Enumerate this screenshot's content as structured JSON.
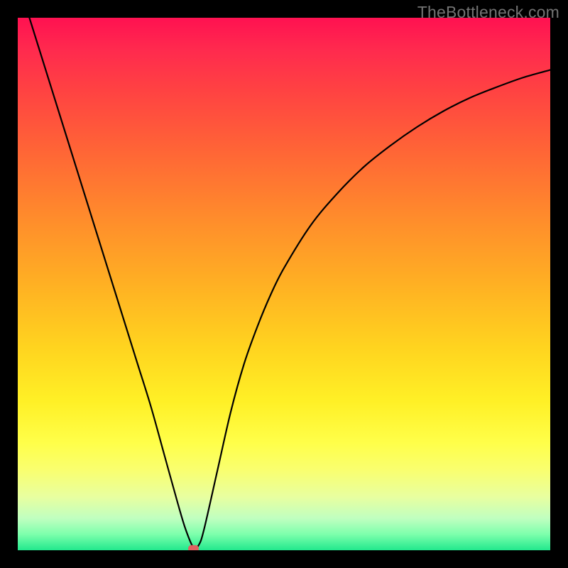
{
  "watermark": "TheBottleneck.com",
  "chart_data": {
    "type": "line",
    "title": "",
    "xlabel": "",
    "ylabel": "",
    "xlim": [
      0,
      100
    ],
    "ylim": [
      0,
      100
    ],
    "grid": false,
    "legend": false,
    "series": [
      {
        "name": "bottleneck-curve",
        "x": [
          0,
          2.5,
          5,
          7.5,
          10,
          12.5,
          15,
          17.5,
          20,
          22.5,
          25,
          27.5,
          30,
          31.5,
          33,
          34,
          35,
          37.5,
          40,
          42.5,
          45,
          47.5,
          50,
          55,
          60,
          65,
          70,
          75,
          80,
          85,
          90,
          95,
          100
        ],
        "y": [
          107,
          99,
          91,
          83,
          75,
          67,
          59,
          51,
          43,
          35,
          27,
          18,
          9,
          4,
          0.5,
          1,
          4,
          15,
          26,
          35,
          42,
          48,
          53,
          61,
          67,
          72,
          76,
          79.5,
          82.5,
          85,
          87,
          88.8,
          90.2
        ]
      }
    ],
    "marker": {
      "x": 33,
      "y": 0.3,
      "shape": "rounded-rect",
      "color": "#e06060"
    },
    "background_gradient": {
      "stops": [
        {
          "pos": 0,
          "color": "#ff1151"
        },
        {
          "pos": 0.5,
          "color": "#ffb023"
        },
        {
          "pos": 0.8,
          "color": "#ffff4a"
        },
        {
          "pos": 1.0,
          "color": "#22e88d"
        }
      ]
    }
  }
}
